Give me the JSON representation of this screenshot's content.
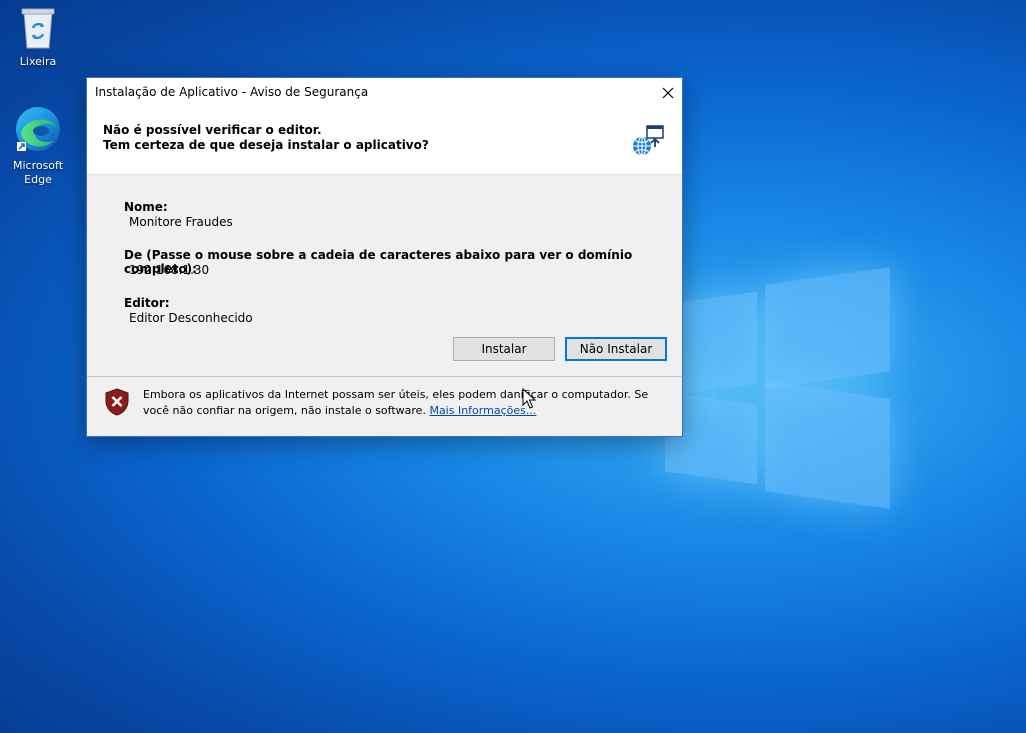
{
  "desktop": {
    "icons": [
      {
        "label": "Lixeira"
      },
      {
        "label": "Microsoft Edge"
      }
    ]
  },
  "dialog": {
    "title": "Instalação de Aplicativo - Aviso de Segurança",
    "header": {
      "line1": "Não é possível verificar o editor.",
      "line2": "Tem certeza de que deseja instalar o aplicativo?"
    },
    "fields": {
      "name_label": "Nome:",
      "name_value": "Monitore Fraudes",
      "from_label": "De (Passe o mouse sobre a cadeia de caracteres abaixo para ver o domínio completo):",
      "from_value": "192.168.1.30",
      "publisher_label": "Editor:",
      "publisher_value": "Editor Desconhecido"
    },
    "buttons": {
      "install": "Instalar",
      "no_install": "Não Instalar"
    },
    "footer": {
      "message": "Embora os aplicativos da Internet possam ser úteis, eles podem danificar o computador. Se você não confiar na origem, não instale o software.",
      "link": "Mais Informações..."
    }
  },
  "colors": {
    "accent": "#0078d7",
    "shield": "#8b1c1c",
    "link": "#0645ad"
  }
}
